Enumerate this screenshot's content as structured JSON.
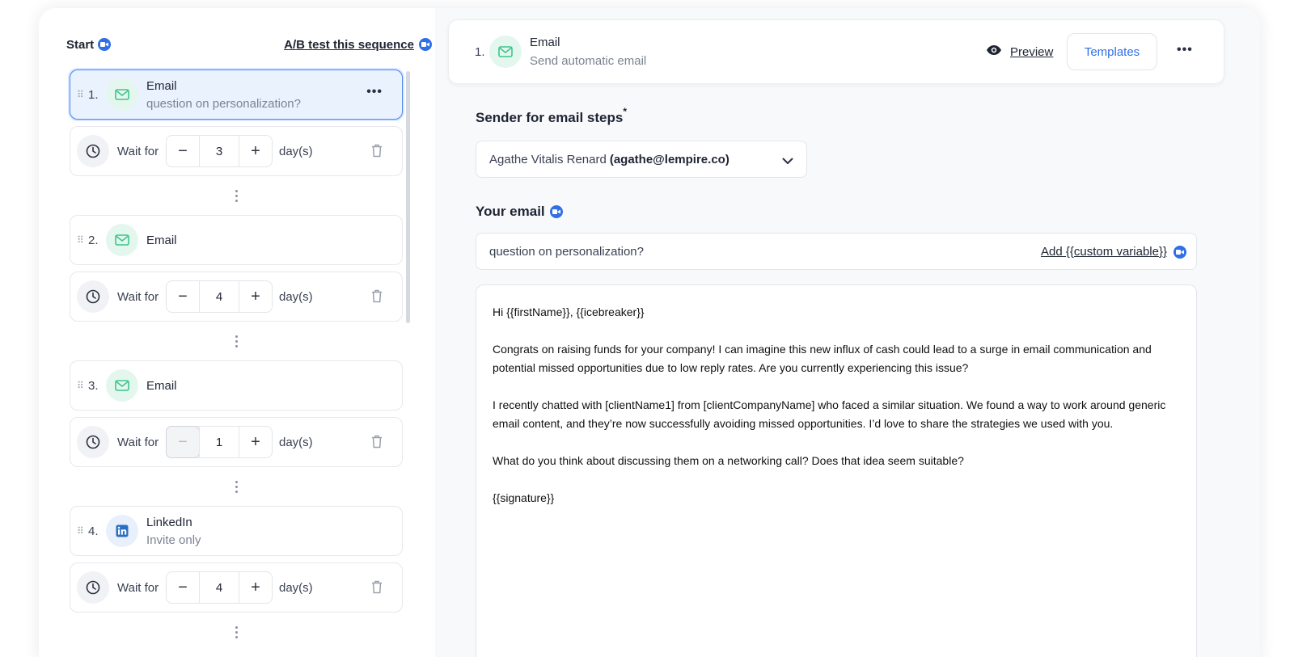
{
  "left_panel": {
    "start_label": "Start",
    "ab_test_label": "A/B test this sequence",
    "steps": [
      {
        "number": "1.",
        "type": "Email",
        "subtitle": "question on personalization?",
        "active": true,
        "wait": {
          "label": "Wait for",
          "value": "3",
          "unit": "day(s)"
        }
      },
      {
        "number": "2.",
        "type": "Email",
        "subtitle": "",
        "wait": {
          "label": "Wait for",
          "value": "4",
          "unit": "day(s)"
        }
      },
      {
        "number": "3.",
        "type": "Email",
        "subtitle": "",
        "wait": {
          "label": "Wait for",
          "value": "1",
          "unit": "day(s)"
        }
      },
      {
        "number": "4.",
        "type": "LinkedIn",
        "subtitle": "Invite only",
        "wait": {
          "label": "Wait for",
          "value": "4",
          "unit": "day(s)"
        }
      }
    ]
  },
  "top_card": {
    "number": "1.",
    "title": "Email",
    "subtitle": "Send automatic email",
    "preview_label": "Preview",
    "templates_label": "Templates"
  },
  "sender": {
    "label": "Sender for email steps",
    "required_mark": "*",
    "name": "Agathe Vitalis Renard",
    "email": "(agathe@lempire.co)"
  },
  "your_email": {
    "label": "Your email",
    "subject": "question on personalization?",
    "add_variable_label": "Add {{custom variable}}",
    "body": [
      "Hi {{firstName}}, {{icebreaker}}",
      "Congrats on raising funds for your company! I can imagine this new influx of cash could lead to a surge in email communication and potential missed opportunities due to low reply rates. Are you currently experiencing this issue?",
      "I recently chatted with [clientName1] from [clientCompanyName] who faced a similar situation. We found a way to work around generic email content, and they’re now successfully avoiding missed opportunities. I’d love to share the strategies we used with you.",
      "What do you think about discussing them on a networking call? Does that idea seem suitable?",
      "{{signature}}"
    ]
  },
  "colors": {
    "accent": "#2f6fe8",
    "active_bg": "#eaf2fe",
    "email_green": "#3ec48a",
    "linkedin_blue": "#2a6fc4"
  },
  "icons": [
    "video-icon",
    "email-icon",
    "linkedin-icon",
    "clock-icon",
    "trash-icon",
    "eye-icon",
    "chevron-down-icon",
    "more-dots-icon",
    "drag-handle-icon"
  ]
}
